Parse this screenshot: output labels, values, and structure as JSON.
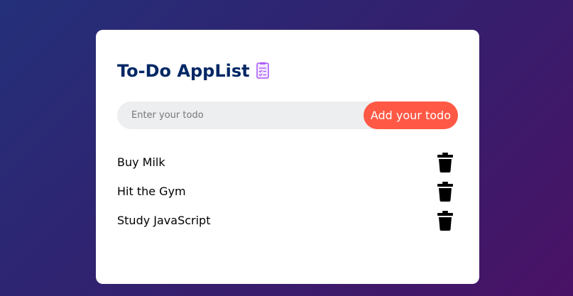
{
  "app": {
    "title": "To-Do AppList",
    "title_icon": "checklist-icon"
  },
  "form": {
    "placeholder": "Enter your todo",
    "value": "",
    "add_button_label": "Add your todo"
  },
  "todos": [
    {
      "text": "Buy Milk",
      "delete_icon": "trash-icon"
    },
    {
      "text": "Hit the Gym",
      "delete_icon": "trash-icon"
    },
    {
      "text": "Study JavaScript",
      "delete_icon": "trash-icon"
    }
  ],
  "colors": {
    "title": "#002765",
    "accent_button": "#ff5945",
    "input_background": "#edeef0",
    "background_gradient_start": "#24307a",
    "background_gradient_end": "#4a1266"
  }
}
